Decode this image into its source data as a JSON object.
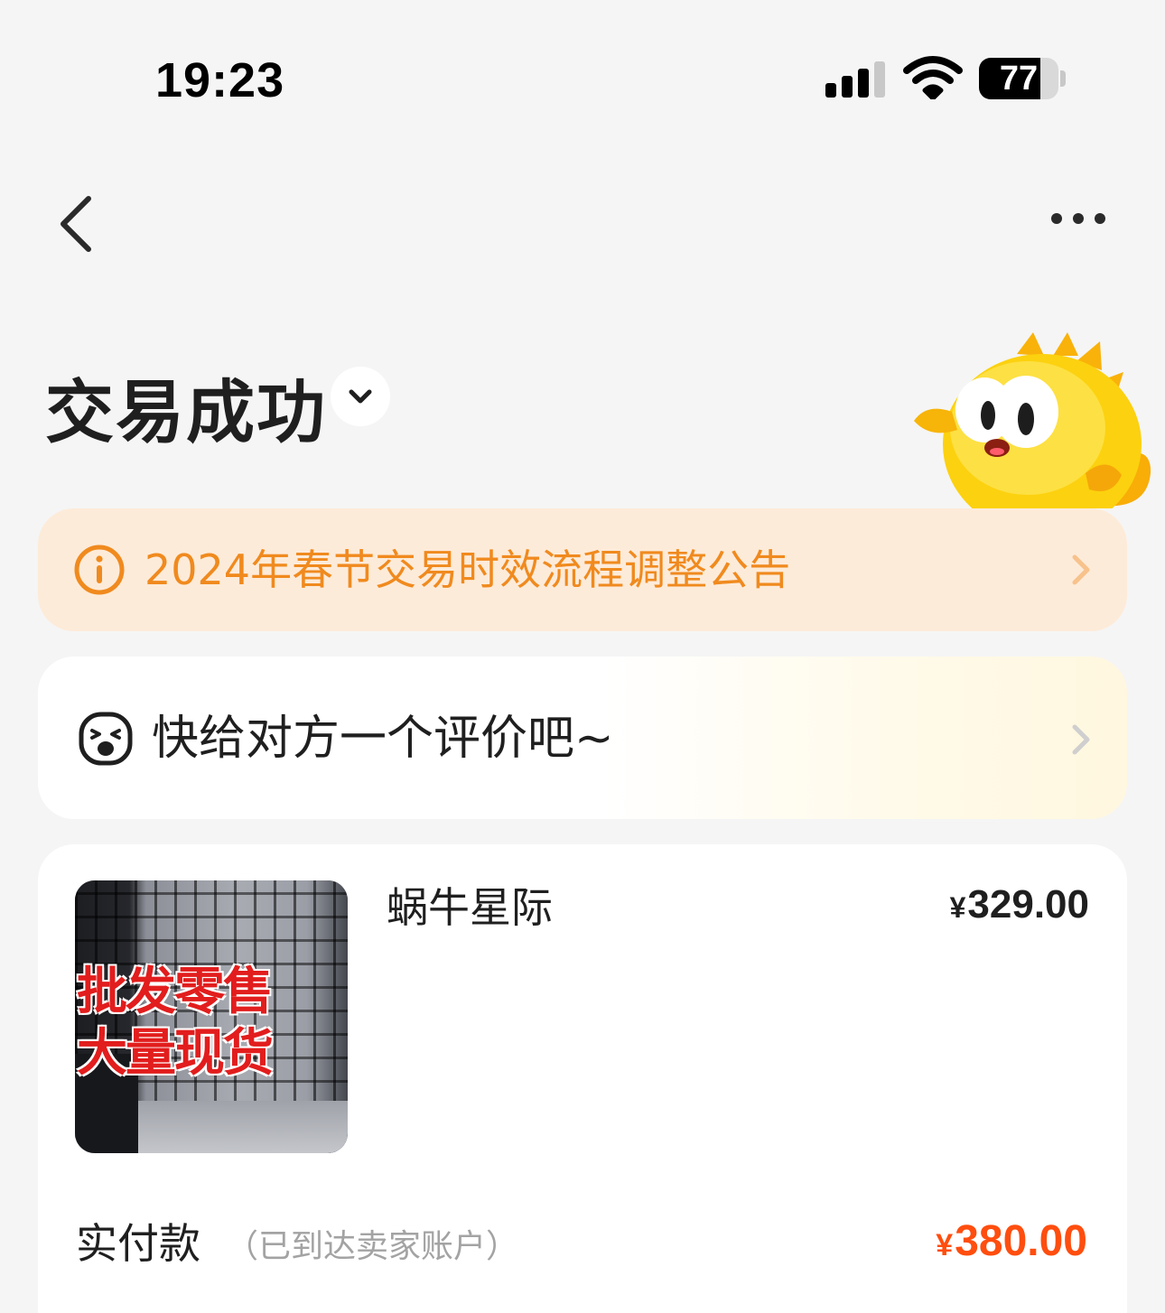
{
  "status_bar": {
    "time": "19:23",
    "battery_level": "77",
    "battery_fraction": 0.77,
    "icons": [
      "signal-icon",
      "wifi-icon",
      "battery-icon"
    ]
  },
  "nav": {
    "back_icon": "chevron-left-icon",
    "more_icon": "more-horizontal-icon"
  },
  "header": {
    "title": "交易成功",
    "toggle_icon": "chevron-down-icon",
    "mascot": "yellow-fish-mascot"
  },
  "notice": {
    "icon": "info-icon",
    "text": "2024年春节交易时效流程调整公告",
    "chevron_icon": "chevron-right-icon",
    "color": "#f08a1e",
    "background": "#fdebd9"
  },
  "review_prompt": {
    "icon": "smiley-face-icon",
    "text": "快给对方一个评价吧~",
    "chevron_icon": "chevron-right-icon"
  },
  "order": {
    "product_image": {
      "line1": "批发零售",
      "line2": "大量现货"
    },
    "product_name": "蜗牛星际",
    "product_price_symbol": "¥",
    "product_price": "329.00",
    "paid_label": "实付款",
    "paid_note": "（已到达卖家账户）",
    "paid_symbol": "¥",
    "paid_amount": "380.00",
    "paid_color": "#ff4e0f"
  }
}
